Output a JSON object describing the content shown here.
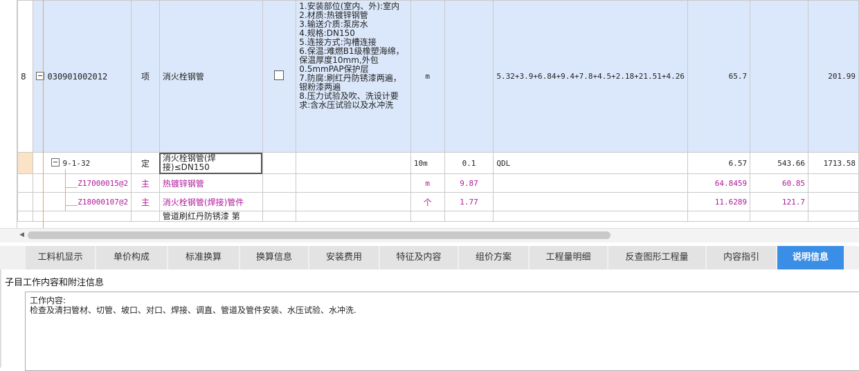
{
  "rows": {
    "r8": {
      "num": "8",
      "code": "030901002012",
      "type": "项",
      "name": "消火栓钢管",
      "features": [
        "1.安装部位(室内、外):室内",
        "2.材质:热镀锌钢管",
        "3.输送介质:泵房水",
        "4.规格:DN150",
        "5.连接方式:沟槽连接",
        "6.保温:难燃B1级橡塑海绵，保温厚度10mm,外包0.5mmPAP保护层",
        "7.防腐:刷红丹防锈漆两遍，银粉漆两遍",
        "8.压力试验及吹、洗设计要求:含水压试验以及水冲洗"
      ],
      "unit": "m",
      "expr": "5.32+3.9+6.84+9.4+7.8+4.5+2.18+21.51+4.26",
      "qty": "65.7",
      "total": "201.99"
    },
    "r_sub": {
      "code": "9-1-32",
      "type": "定",
      "name": "消火栓钢管(焊接)≤DN150",
      "unit": "10m",
      "content_qty": "0.1",
      "expr": "QDL",
      "qty": "6.57",
      "price": "543.66",
      "total": "1713.58"
    },
    "r_m1": {
      "code": "Z17000015@2",
      "type": "主",
      "name": "热镀锌钢管",
      "unit": "m",
      "content_qty": "9.87",
      "qty": "64.8459",
      "price": "60.85"
    },
    "r_m2": {
      "code": "Z18000107@2",
      "type": "主",
      "name": "消火栓钢管(焊接)管件",
      "unit": "个",
      "content_qty": "1.77",
      "qty": "11.6289",
      "price": "121.7"
    },
    "r_trunc": {
      "name": "管道刷红丹防锈漆 第"
    }
  },
  "tabs": [
    {
      "label": "工料机显示"
    },
    {
      "label": "单价构成"
    },
    {
      "label": "标准换算"
    },
    {
      "label": "换算信息"
    },
    {
      "label": "安装费用"
    },
    {
      "label": "特征及内容"
    },
    {
      "label": "组价方案"
    },
    {
      "label": "工程量明细"
    },
    {
      "label": "反查图形工程量"
    },
    {
      "label": "内容指引"
    },
    {
      "label": "说明信息"
    }
  ],
  "active_tab": "说明信息",
  "info": {
    "heading": "子目工作内容和附注信息",
    "line1": "工作内容:",
    "line2": "检查及清扫管材、切管、坡口、对口、焊接、调直、管道及管件安装、水压试验、水冲洗."
  },
  "colors": {
    "row_highlight": "#dbe8fb",
    "main_material_text": "#b0189a",
    "active_tab": "#3b8ee6"
  }
}
